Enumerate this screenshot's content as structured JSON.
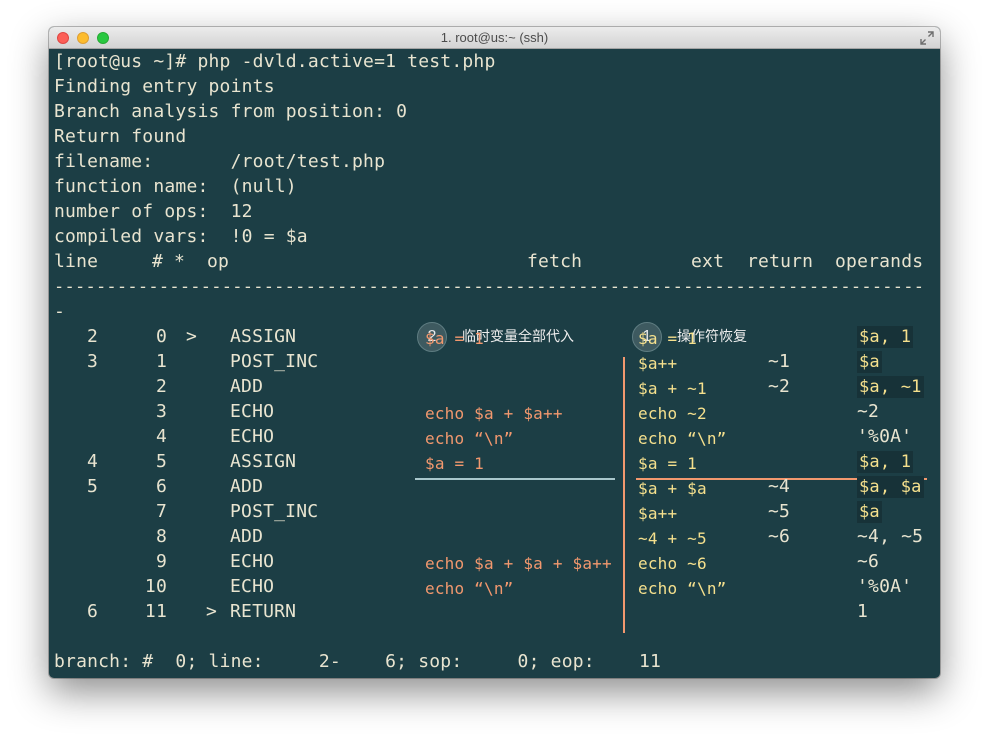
{
  "window": {
    "title": "1. root@us:~ (ssh)"
  },
  "header_lines": [
    "[root@us ~]# php -dvld.active=1 test.php",
    "Finding entry points",
    "Branch analysis from position: 0",
    "Return found",
    "filename:       /root/test.php",
    "function name:  (null)",
    "number of ops:  12",
    "compiled vars:  !0 = $a"
  ],
  "columns": {
    "line": "line",
    "num": "#",
    "star": "*",
    "op": "op",
    "fetch": "fetch",
    "ext": "ext",
    "return": "return",
    "operands": "operands"
  },
  "separator": "-----------------------------------------------------------------------------------",
  "separator_wrap": "-",
  "annotations": {
    "temp_badge": "2",
    "temp_label": "临时变量全部代入",
    "ops_badge": "1",
    "ops_label": "操作符恢复"
  },
  "rows": [
    {
      "line": "2",
      "num": "0",
      "flag": ">",
      "op": "ASSIGN",
      "left": "$a = 1",
      "right": "$a = 1",
      "ret": "",
      "operands": "$a, 1"
    },
    {
      "line": "3",
      "num": "1",
      "flag": "",
      "op": "POST_INC",
      "left": "",
      "right": "$a++",
      "ret": "~1",
      "operands": "$a"
    },
    {
      "line": "",
      "num": "2",
      "flag": "",
      "op": "ADD",
      "left": "",
      "right": "$a + ~1",
      "ret": "~2",
      "operands": "$a, ~1"
    },
    {
      "line": "",
      "num": "3",
      "flag": "",
      "op": "ECHO",
      "left": "echo $a + $a++",
      "right": "echo ~2",
      "ret": "",
      "operands": "~2"
    },
    {
      "line": "",
      "num": "4",
      "flag": "",
      "op": "ECHO",
      "left": "echo “\\n”",
      "right": "echo “\\n”",
      "ret": "",
      "operands": "'%0A'"
    },
    {
      "line": "4",
      "num": "5",
      "flag": "",
      "op": "ASSIGN",
      "left": "$a = 1",
      "right": "$a = 1",
      "ret": "",
      "operands": "$a, 1"
    },
    {
      "line": "5",
      "num": "6",
      "flag": "",
      "op": "ADD",
      "left": "",
      "right": "$a + $a",
      "ret": "~4",
      "operands": "$a, $a"
    },
    {
      "line": "",
      "num": "7",
      "flag": "",
      "op": "POST_INC",
      "left": "",
      "right": "$a++",
      "ret": "~5",
      "operands": "$a"
    },
    {
      "line": "",
      "num": "8",
      "flag": "",
      "op": "ADD",
      "left": "",
      "right": "~4 + ~5",
      "ret": "~6",
      "operands": "~4, ~5"
    },
    {
      "line": "",
      "num": "9",
      "flag": "",
      "op": "ECHO",
      "left": "echo $a + $a + $a++",
      "right": "echo ~6",
      "ret": "",
      "operands": "~6"
    },
    {
      "line": "",
      "num": "10",
      "flag": "",
      "op": "ECHO",
      "left": "echo “\\n”",
      "right": "echo “\\n”",
      "ret": "",
      "operands": "'%0A'"
    },
    {
      "line": "6",
      "num": "11",
      "flag": ">",
      "op": "RETURN",
      "left": "",
      "right": "",
      "ret": "",
      "operands": "1"
    }
  ],
  "footer": "branch: #  0; line:     2-    6; sop:     0; eop:    11",
  "colors": {
    "background": "#1c3e45",
    "text": "#e8e4d0",
    "temp_substitution": "#f2986e",
    "operator_recovery": "#f5e08d",
    "left_divider": "#a9c7cc",
    "right_divider": "#f2986e"
  }
}
